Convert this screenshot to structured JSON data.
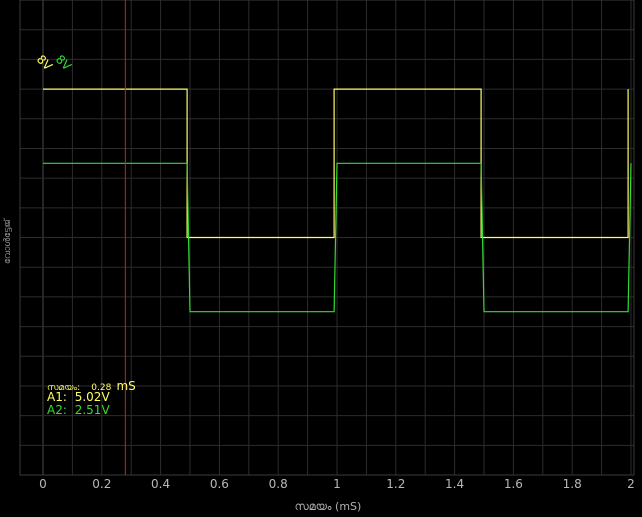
{
  "colors": {
    "background": "#000000",
    "grid": "#2c2c2c",
    "grid_zero": "#4a4a4a",
    "channel_a1": "#ffff66",
    "channel_a2": "#33dd33",
    "cursor": "#cc2222"
  },
  "chart_data": {
    "type": "line",
    "xlabel": "സമയം (mS)",
    "ylabel": "വോൾട്ടേജ്",
    "xlim": [
      0,
      2
    ],
    "x_ticks": [
      "0",
      "0.2",
      "0.4",
      "0.6",
      "0.8",
      "1",
      "1.2",
      "1.4",
      "1.6",
      "1.8",
      "2"
    ],
    "range_labels": [
      {
        "text": "8V",
        "color": "#ffff66"
      },
      {
        "text": "8V",
        "color": "#33dd33"
      }
    ],
    "ylim": [
      -8,
      8
    ],
    "grid": true,
    "series": [
      {
        "name": "A1",
        "color": "#ffff66",
        "x": [
          0,
          0.49,
          0.49,
          0.99,
          0.99,
          1.49,
          1.49,
          1.99,
          1.99
        ],
        "y": [
          5.0,
          5.0,
          0.0,
          0.0,
          5.0,
          5.0,
          0.0,
          0.0,
          5.0
        ]
      },
      {
        "name": "A2",
        "color": "#33dd33",
        "x": [
          0,
          0.49,
          0.5,
          0.99,
          1.0,
          1.49,
          1.5,
          1.99,
          2.0
        ],
        "y": [
          2.5,
          2.5,
          -2.5,
          -2.5,
          2.5,
          2.5,
          -2.5,
          -2.5,
          2.5
        ]
      }
    ],
    "cursor": {
      "x": 0.28,
      "time_label": "സമയം:",
      "time_value": "0.28",
      "time_unit": "mS",
      "readings": [
        {
          "channel": "A1:",
          "value": "5.02V",
          "color": "#ffff66"
        },
        {
          "channel": "A2:",
          "value": "2.51V",
          "color": "#33dd33"
        }
      ]
    }
  }
}
